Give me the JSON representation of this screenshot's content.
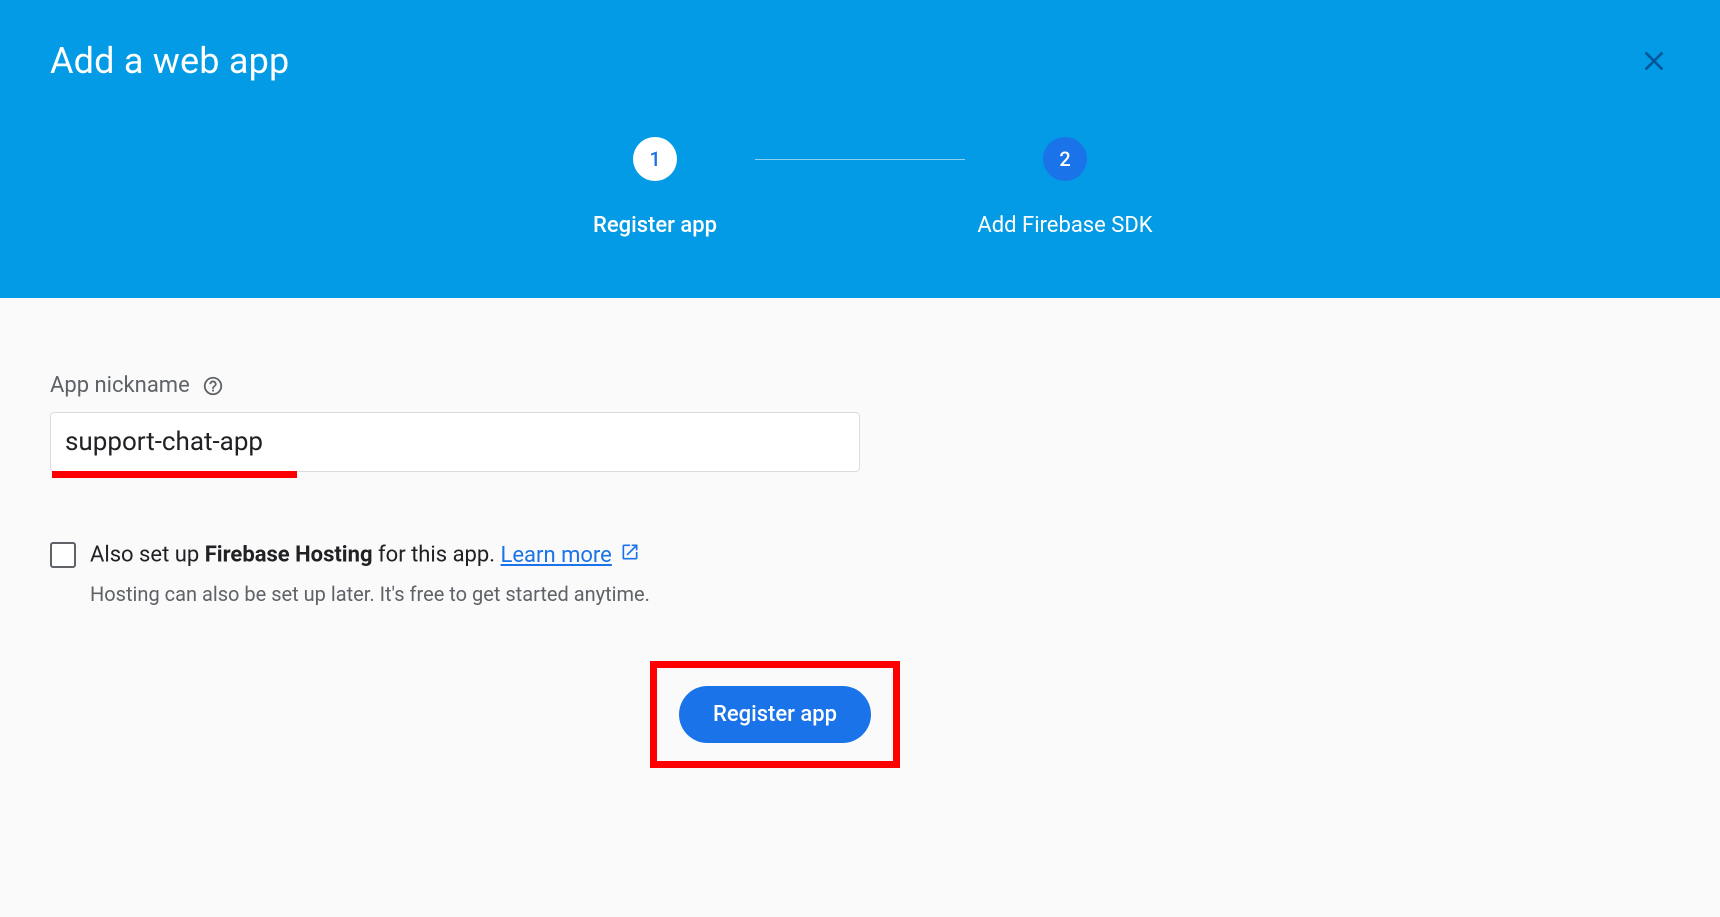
{
  "header": {
    "title": "Add a web app"
  },
  "stepper": {
    "step1": {
      "number": "1",
      "label": "Register app"
    },
    "step2": {
      "number": "2",
      "label": "Add Firebase SDK"
    }
  },
  "form": {
    "nickname_label": "App nickname",
    "nickname_value": "support-chat-app",
    "hosting_prefix": "Also set up ",
    "hosting_bold": "Firebase Hosting",
    "hosting_suffix": " for this app. ",
    "learn_more": "Learn more",
    "hosting_subtext": "Hosting can also be set up later. It's free to get started anytime.",
    "register_button": "Register app"
  }
}
